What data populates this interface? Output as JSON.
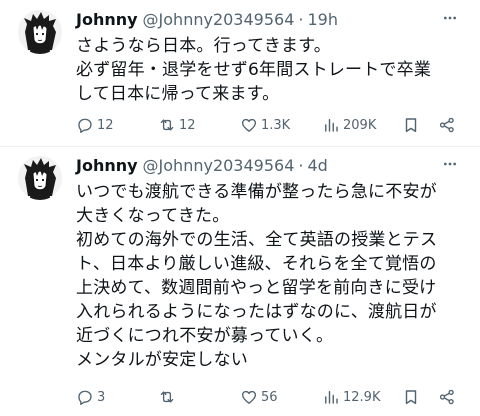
{
  "tweets": [
    {
      "author_name": "Johnny",
      "handle": "@Johnny20349564",
      "separator": "·",
      "time": "19h",
      "text_lines": [
        "さようなら日本。行ってきます。",
        "必ず留年・退学をせず6年間ストレートで卒業",
        "して日本に帰って来ます。"
      ],
      "stats": {
        "replies": "12",
        "retweets": "12",
        "likes": "1.3K",
        "views": "209K"
      }
    },
    {
      "author_name": "Johnny",
      "handle": "@Johnny20349564",
      "separator": "·",
      "time": "4d",
      "text_lines": [
        "いつでも渡航できる準備が整ったら急に不安が",
        "大きくなってきた。",
        "初めての海外での生活、全て英語の授業とテス",
        "ト、日本より厳しい進級、それらを全て覚悟の",
        "上決めて、数週間前やっと留学を前向きに受け",
        "入れられるようになったはずなのに、渡航日が",
        "近づくにつれ不安が募っていく。",
        "メンタルが安定しない"
      ],
      "stats": {
        "replies": "3",
        "retweets": "",
        "likes": "56",
        "views": "12.9K"
      }
    }
  ],
  "icons": {
    "more": "more-horizontal-icon",
    "reply": "reply-icon",
    "retweet": "retweet-icon",
    "like": "heart-icon",
    "views": "views-chart-icon",
    "bookmark": "bookmark-icon",
    "share": "share-icon"
  },
  "colors": {
    "text": "#0f1419",
    "secondary": "#536471",
    "divider": "#eff3f4"
  }
}
